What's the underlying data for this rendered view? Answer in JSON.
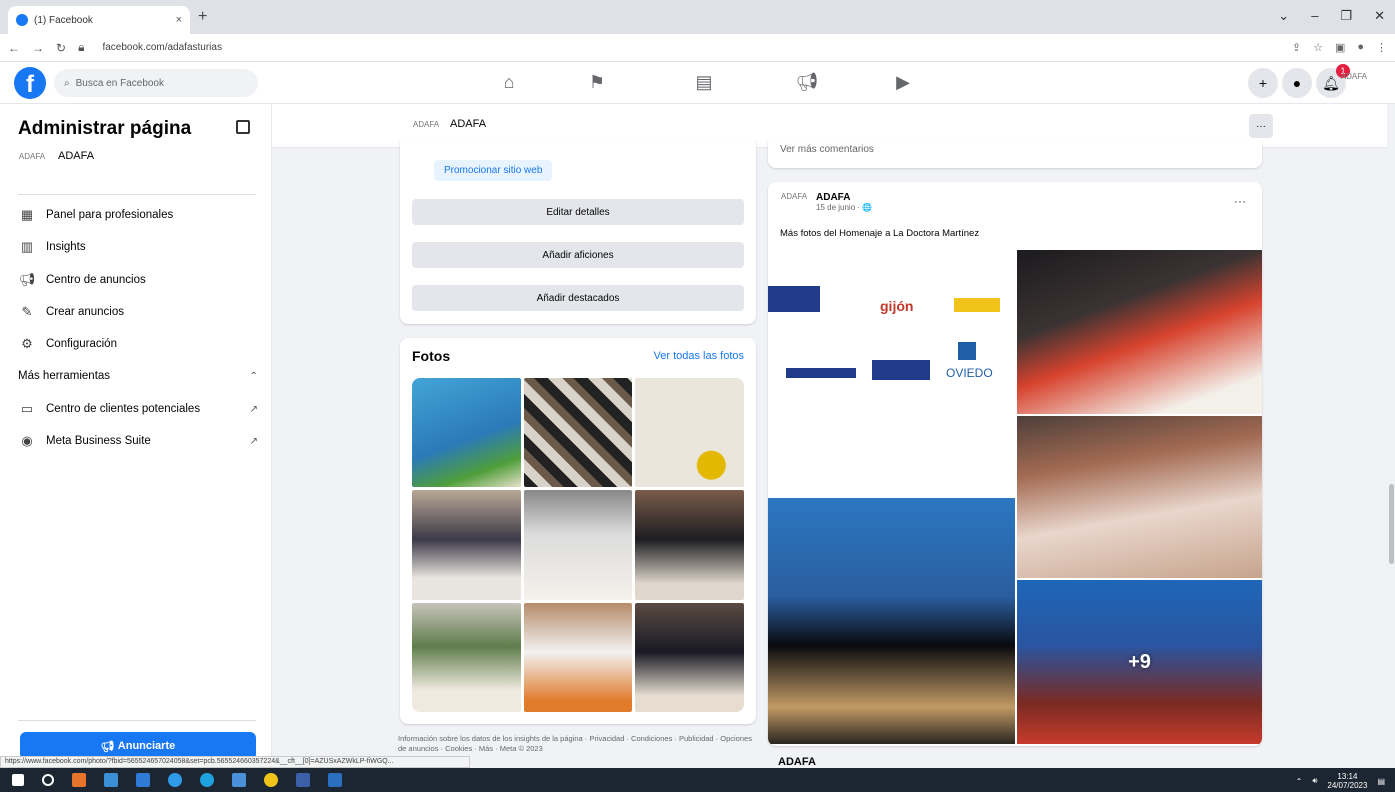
{
  "browser": {
    "tab_title": "(1) Facebook",
    "tab_close": "×",
    "new_tab": "+",
    "url": "facebook.com/adafasturias",
    "window_controls": [
      "⌄",
      "–",
      "❐",
      "✕"
    ]
  },
  "fbnav": {
    "logo": "f",
    "search_placeholder": "Busca en Facebook",
    "notification_count": "1",
    "profile_mini": "ADAFA"
  },
  "sidebar": {
    "title": "Administrar página",
    "page_name": "ADAFA",
    "menu": [
      {
        "label": "Panel para profesionales",
        "icon": "dashboard-icon"
      },
      {
        "label": "Insights",
        "icon": "insights-icon"
      },
      {
        "label": "Centro de anuncios",
        "icon": "megaphone-icon"
      },
      {
        "label": "Crear anuncios",
        "icon": "edit-icon"
      },
      {
        "label": "Configuración",
        "icon": "gear-icon"
      }
    ],
    "more_tools": "Más herramientas",
    "more_tools_items": [
      {
        "label": "Centro de clientes potenciales",
        "icon": "leads-icon"
      },
      {
        "label": "Meta Business Suite",
        "icon": "meta-icon"
      }
    ],
    "advertise_button": "Anunciarte"
  },
  "header": {
    "page_name": "ADAFA",
    "more_button": "···"
  },
  "about_card": {
    "promote_link": "Promocionar sitio web",
    "buttons": [
      "Editar detalles",
      "Añadir aficiones",
      "Añadir destacados"
    ]
  },
  "photos_card": {
    "title": "Fotos",
    "see_all": "Ver todas las fotos"
  },
  "footer": {
    "text": "Información sobre los datos de los insights de la página · Privacidad · Condiciones · Publicidad · Opciones de anuncios · Cookies · Más · Meta © 2023"
  },
  "comments_card": {
    "see_more": "Ver más comentarios"
  },
  "post": {
    "author": "ADAFA",
    "date": "15 de junio · 🌐",
    "more": "···",
    "text": "Más fotos del Homenaje a La Doctora Martínez",
    "more_photos": "+9",
    "logos": [
      "gijón",
      "OVIEDO"
    ]
  },
  "next_post": {
    "author": "ADAFA"
  },
  "status_url": "https://www.facebook.com/photo/?fbid=565524657024058&set=pcb.565524660357224&__cft__[0]=AZUSxAZWkLP-fiWGQ...",
  "taskbar": {
    "time": "13:14",
    "date": "24/07/2023"
  }
}
